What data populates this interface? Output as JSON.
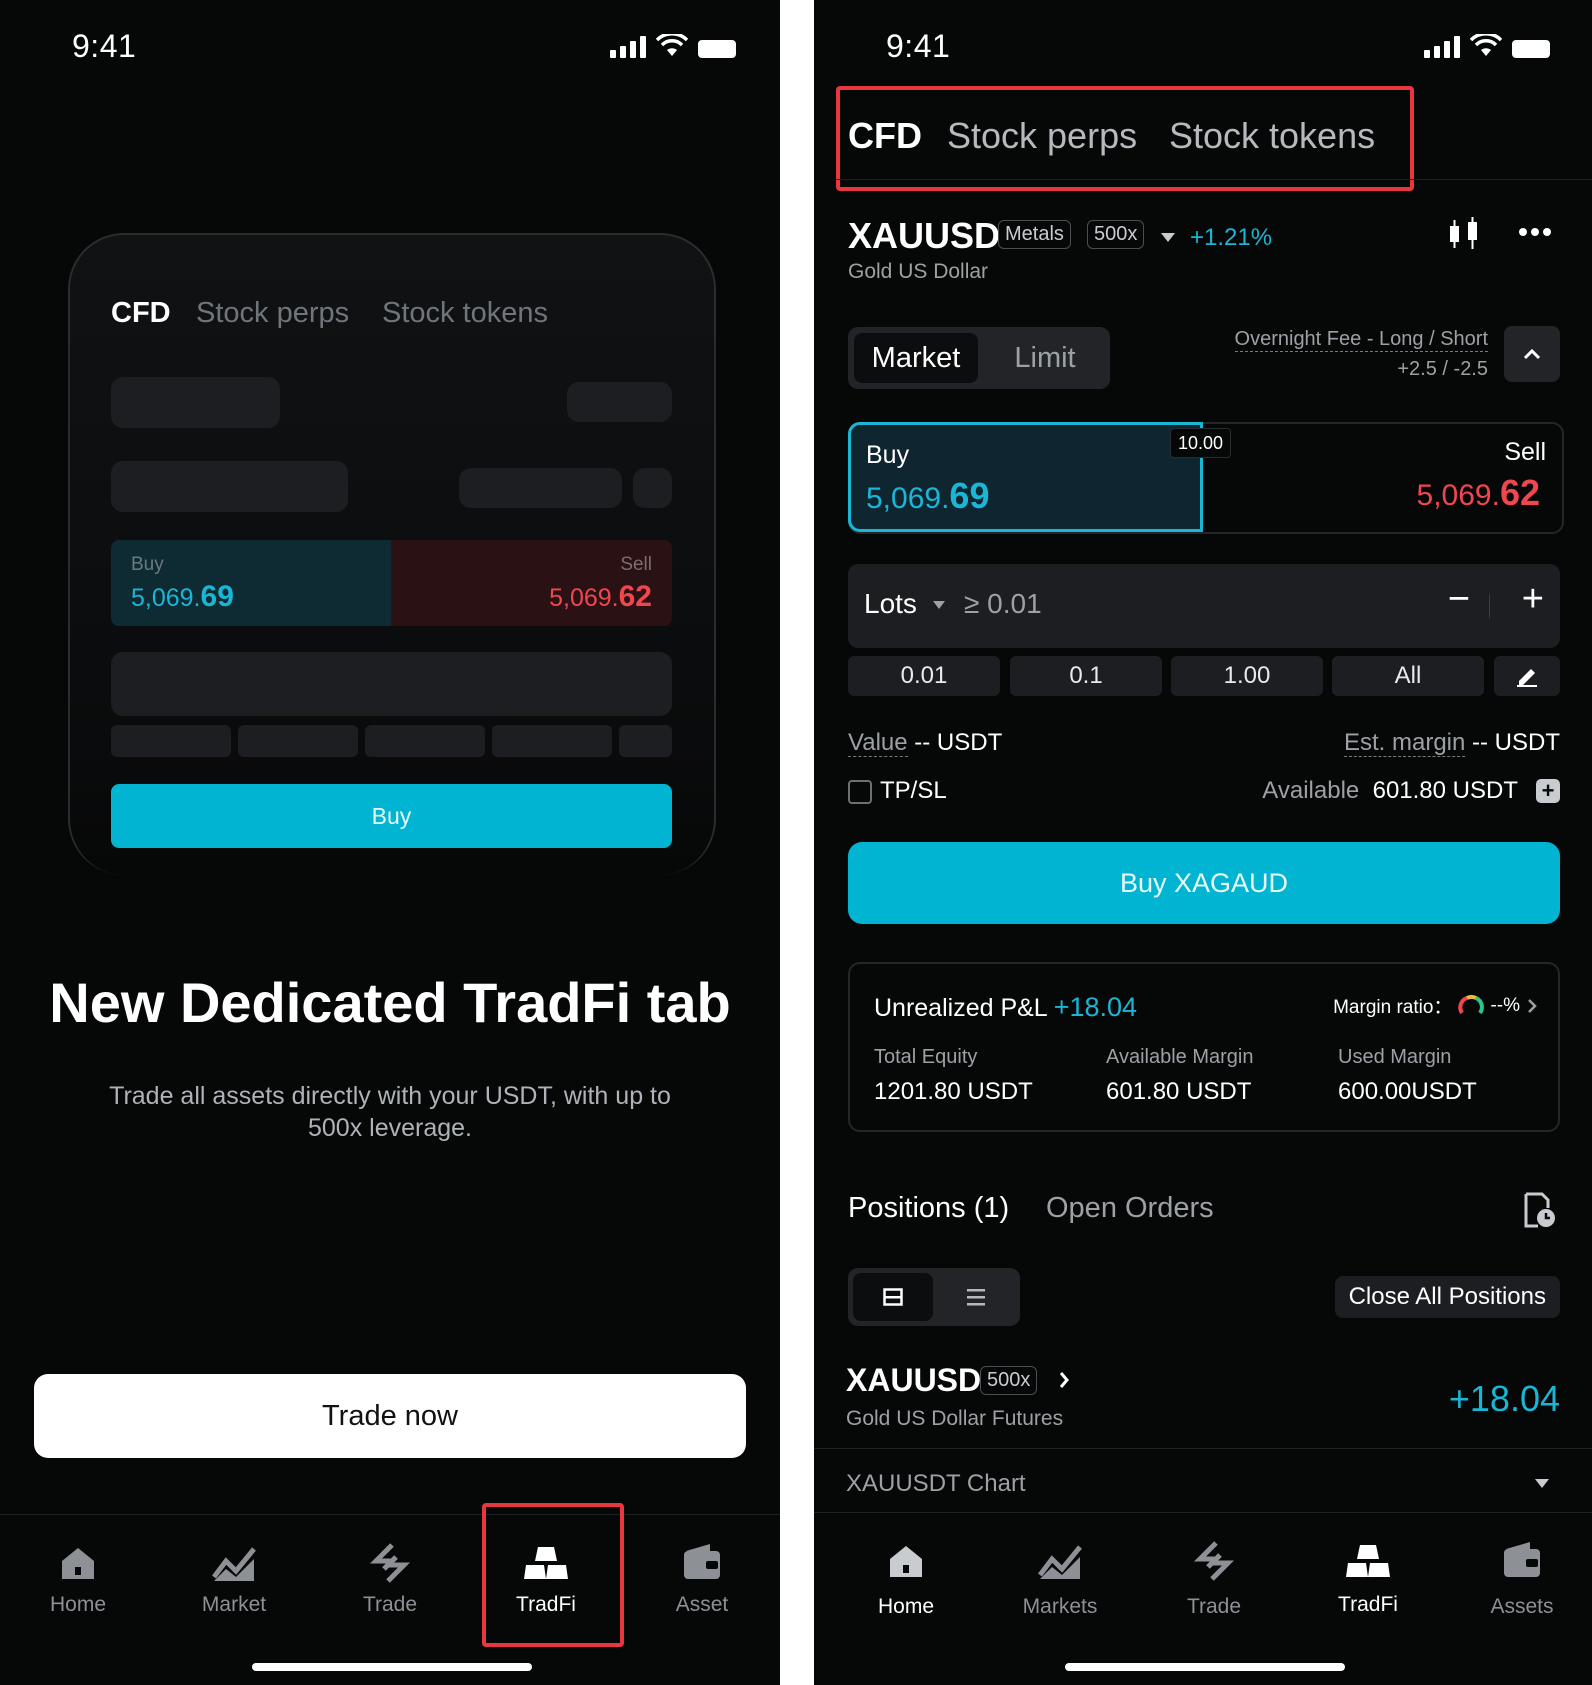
{
  "left": {
    "status": {
      "time": "9:41"
    },
    "mock": {
      "tabs": [
        "CFD",
        "Stock perps",
        "Stock tokens"
      ],
      "buy_label": "Buy",
      "buy_price_main": "5,069.",
      "buy_price_accent": "69",
      "sell_label": "Sell",
      "sell_price_main": "5,069.",
      "sell_price_accent": "62",
      "buy_button": "Buy"
    },
    "headline": "New Dedicated TradFi tab",
    "subtext": "Trade all assets directly with your USDT, with up to 500x leverage.",
    "cta": "Trade now",
    "nav": [
      {
        "label": "Home",
        "icon": "home-icon"
      },
      {
        "label": "Market",
        "icon": "market-chart-icon"
      },
      {
        "label": "Trade",
        "icon": "trade-arrows-icon"
      },
      {
        "label": "TradFi",
        "icon": "gold-bars-icon"
      },
      {
        "label": "Asset",
        "icon": "wallet-icon"
      }
    ]
  },
  "right": {
    "status": {
      "time": "9:41"
    },
    "tabs": [
      "CFD",
      "Stock perps",
      "Stock tokens"
    ],
    "instrument": {
      "symbol": "XAUUSD",
      "category": "Metals",
      "leverage": "500x",
      "change": "+1.21%",
      "name": "Gold  US Dollar"
    },
    "order_types": [
      "Market",
      "Limit"
    ],
    "overnight_fee": {
      "label": "Overnight Fee - Long / Short",
      "value": "+2.5 / -2.5"
    },
    "quote": {
      "buy_label": "Buy",
      "buy_main": "5,069.",
      "buy_accent": "69",
      "spread": "10.00",
      "sell_label": "Sell",
      "sell_main": "5,069.",
      "sell_accent": "62"
    },
    "lots": {
      "label": "Lots",
      "min": "≥ 0.01",
      "minus": "−",
      "plus": "+"
    },
    "quick_amounts": [
      "0.01",
      "0.1",
      "1.00",
      "All"
    ],
    "value": {
      "label": "Value",
      "amount": "-- USDT"
    },
    "est_margin": {
      "label": "Est. margin",
      "amount": "-- USDT"
    },
    "tpsl_label": "TP/SL",
    "available": {
      "label": "Available",
      "amount": "601.80 USDT"
    },
    "buy_button": "Buy XAGAUD",
    "account": {
      "pnl_label": "Unrealized P&L",
      "pnl_value": "+18.04",
      "margin_ratio_label": "Margin ratio：",
      "margin_ratio_value": "--%",
      "stats": [
        {
          "label": "Total Equity",
          "value": "1201.80 USDT"
        },
        {
          "label": "Available Margin",
          "value": "601.80 USDT"
        },
        {
          "label": "Used Margin",
          "value": "600.00USDT"
        }
      ]
    },
    "positions_tabs": [
      "Positions (1)",
      "Open Orders"
    ],
    "close_all": "Close All Positions",
    "position": {
      "symbol": "XAUUSD",
      "leverage": "500x",
      "name": "Gold US Dollar  Futures",
      "pnl": "+18.04"
    },
    "chart_row": "XAUUSDT  Chart",
    "nav": [
      {
        "label": "Home",
        "icon": "home-icon"
      },
      {
        "label": "Markets",
        "icon": "market-chart-icon"
      },
      {
        "label": "Trade",
        "icon": "trade-arrows-icon"
      },
      {
        "label": "TradFi",
        "icon": "gold-bars-icon"
      },
      {
        "label": "Assets",
        "icon": "wallet-icon"
      }
    ]
  },
  "colors": {
    "accent": "#19b6d6",
    "sell": "#f0464f",
    "highlight": "#e8383d",
    "background": "#060707"
  }
}
